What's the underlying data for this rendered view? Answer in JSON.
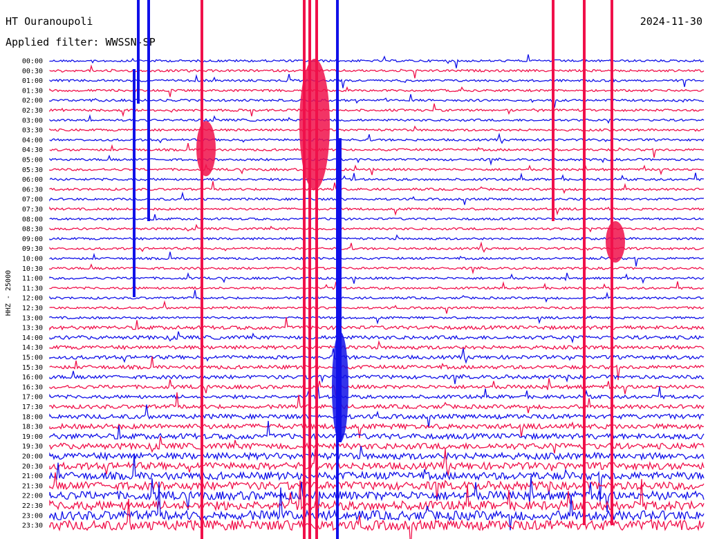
{
  "header": {
    "station": "HT Ouranoupoli",
    "date": "2024-11-30",
    "filter": "Applied filter: WWSSN-SP"
  },
  "colors": {
    "blue": "#1010e8",
    "red": "#f0104a"
  },
  "chart_data": {
    "type": "line",
    "ylabel": "HHZ - 25000",
    "row_labels": [
      "00:00",
      "00:30",
      "01:00",
      "01:30",
      "02:00",
      "02:30",
      "03:00",
      "03:30",
      "04:00",
      "04:30",
      "05:00",
      "05:30",
      "06:00",
      "06:30",
      "07:00",
      "07:30",
      "08:00",
      "08:30",
      "09:00",
      "09:30",
      "10:00",
      "10:30",
      "11:00",
      "11:30",
      "12:00",
      "12:30",
      "13:00",
      "13:30",
      "14:00",
      "14:30",
      "15:00",
      "15:30",
      "16:00",
      "16:30",
      "17:00",
      "17:30",
      "18:00",
      "18:30",
      "19:00",
      "19:30",
      "20:00",
      "20:30",
      "21:00",
      "21:30",
      "22:00",
      "22:30",
      "23:00",
      "23:30"
    ],
    "trace_colors": [
      "blue",
      "red"
    ],
    "row_duration_min": 30
  }
}
